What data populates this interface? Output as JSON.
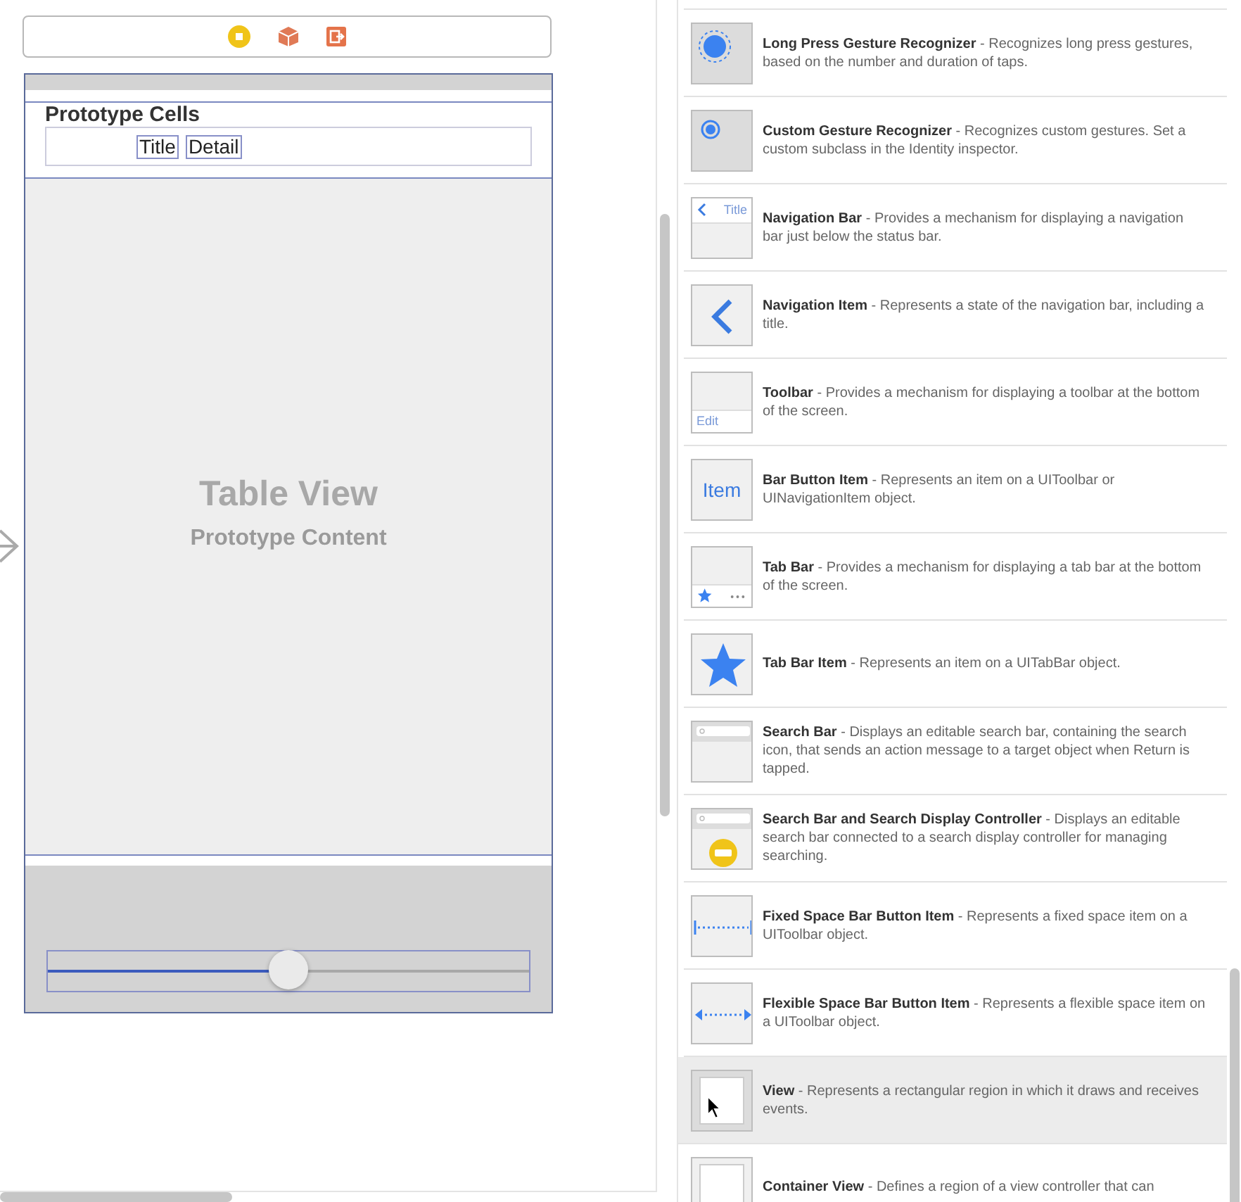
{
  "scene": {
    "section_header": "Prototype Cells",
    "cell": {
      "title": "Title",
      "detail": "Detail"
    },
    "placeholder_title": "Table View",
    "placeholder_subtitle": "Prototype Content",
    "slider": {
      "level": 0.5
    }
  },
  "library": [
    {
      "kind": "long-press",
      "name": "Long Press Gesture Recognizer",
      "description": "- Recognizes long press gestures, based on the number and duration of taps.",
      "selected": false
    },
    {
      "kind": "custom-gesture",
      "name": "Custom Gesture Recognizer",
      "description": "- Recognizes custom gestures. Set a custom subclass in the Identity inspector.",
      "selected": false
    },
    {
      "kind": "nav-bar",
      "icon_text": "Title",
      "name": "Navigation Bar",
      "description": "- Provides a mechanism for displaying a navigation bar just below the status bar.",
      "selected": false
    },
    {
      "kind": "nav-item",
      "name": "Navigation Item",
      "description": "- Represents a state of the navigation bar, including a title.",
      "selected": false
    },
    {
      "kind": "toolbar",
      "icon_text": "Edit",
      "name": "Toolbar",
      "description": "- Provides a mechanism for displaying a toolbar at the bottom of the screen.",
      "selected": false
    },
    {
      "kind": "bar-button",
      "icon_text": "Item",
      "name": "Bar Button Item",
      "description": "- Represents an item on a UIToolbar or UINavigationItem object.",
      "selected": false
    },
    {
      "kind": "tab-bar",
      "name": "Tab Bar",
      "description": "- Provides a mechanism for displaying a tab bar at the bottom of the screen.",
      "selected": false
    },
    {
      "kind": "tab-bar-item",
      "name": "Tab Bar Item",
      "description": "- Represents an item on a UITabBar object.",
      "selected": false
    },
    {
      "kind": "search-bar",
      "name": "Search Bar",
      "description": "- Displays an editable search bar, containing the search icon, that sends an action message to a target object when Return is tapped.",
      "selected": false
    },
    {
      "kind": "search-display",
      "name": "Search Bar and Search Display Controller",
      "description": "- Displays an editable search bar connected to a search display controller for managing searching.",
      "selected": false
    },
    {
      "kind": "fixed-space",
      "name": "Fixed Space Bar Button Item",
      "description": "- Represents a fixed space item on a UIToolbar object.",
      "selected": false
    },
    {
      "kind": "flexible-space",
      "name": "Flexible Space Bar Button Item",
      "description": "- Represents a flexible space item on a UIToolbar object.",
      "selected": false
    },
    {
      "kind": "view",
      "name": "View",
      "description": "- Represents a rectangular region in which it draws and receives events.",
      "selected": true
    },
    {
      "kind": "container-view",
      "name": "Container View",
      "description": "- Defines a region of a view controller that can",
      "selected": false
    }
  ]
}
